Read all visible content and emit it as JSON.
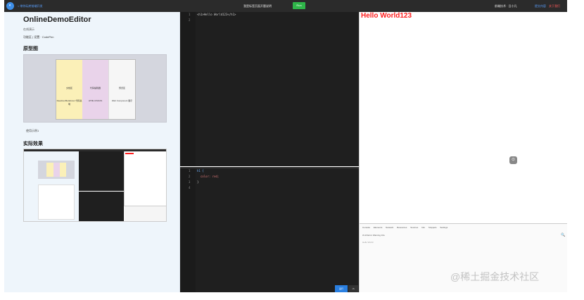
{
  "topbar": {
    "logo_glyph": "◐",
    "left_link": "< 带你玩转前端开发",
    "center_title": "我是标签页面开题说明",
    "run_label": "Run",
    "right_user": "前端技术 · 吕小凡",
    "right_link1": "提交内容",
    "right_link2": "关于我们"
  },
  "doc": {
    "title": "OnlineDemoEditor",
    "subtitle": "在线演示",
    "links": "功能区 | 设置 · CodePen",
    "section_prototype": "原型图",
    "mock_columns": [
      {
        "title": "文档区",
        "desc": "Readme/Markdown 代码说明",
        "bg": "#fbf0b8"
      },
      {
        "title": "代码编辑器",
        "desc": "HTML/CSS/JS",
        "bg": "#e9d3ea"
      },
      {
        "title": "预览区",
        "desc": "Web Component 展示",
        "bg": "#f6f6f6"
      }
    ],
    "mock_note": "使用示例1",
    "section_effect": "实际效果"
  },
  "editor_html": {
    "lines": [
      "1",
      "2"
    ],
    "code": "<h1>Hello World123</h1>"
  },
  "editor_css": {
    "lines": [
      "1",
      "2",
      "3",
      "4"
    ],
    "code_line1": "h1 {",
    "code_line2": "  color: red;",
    "code_line3": "}",
    "button_primary": "运行",
    "button_secondary": "JS"
  },
  "preview": {
    "heading": "Hello World123",
    "heading_color": "#ff1e1e",
    "icon_glyph": "⊙",
    "devtools": {
      "tabs": "Console Elements Network Resources Sources Info Snippets Settings",
      "toolbar": "⊘ All Error Warning Info",
      "row": "Hello World",
      "search_glyph": "🔍"
    }
  },
  "watermark": "@稀土掘金技术社区"
}
